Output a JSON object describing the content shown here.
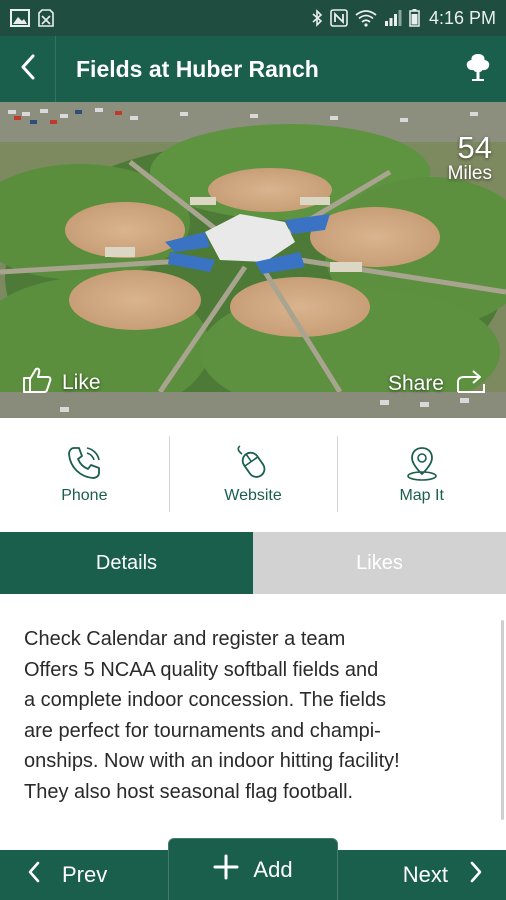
{
  "status_bar": {
    "time": "4:16 PM",
    "left_icons": [
      "image-icon",
      "sim-off-icon"
    ],
    "right_icons": [
      "bluetooth-icon",
      "nfc-icon",
      "wifi-icon",
      "signal-icon",
      "battery-icon"
    ]
  },
  "app_bar": {
    "title": "Fields at Huber Ranch",
    "back_icon": "chevron-left-icon",
    "action_icon": "tree-icon"
  },
  "hero": {
    "distance_value": "54",
    "distance_unit": "Miles",
    "like_label": "Like",
    "share_label": "Share"
  },
  "actions": [
    {
      "label": "Phone",
      "icon": "phone-icon"
    },
    {
      "label": "Website",
      "icon": "mouse-icon"
    },
    {
      "label": "Map It",
      "icon": "map-pin-icon"
    }
  ],
  "tabs": [
    {
      "label": "Details",
      "active": true
    },
    {
      "label": "Likes",
      "active": false
    }
  ],
  "description": {
    "lines": [
      "Check Calendar and register a team",
      "Offers 5 NCAA quality softball fields and",
      "a complete indoor concession. The fields",
      "are perfect for tournaments and champi-",
      "onships. Now with an indoor hitting facility!",
      "They also host seasonal flag football."
    ]
  },
  "bottom_nav": {
    "prev_label": "Prev",
    "add_label": "Add",
    "next_label": "Next"
  },
  "colors": {
    "brand_green": "#1a5f4c",
    "status_bar": "#1f4d3f",
    "inactive_tab": "#d2d2d2",
    "text": "#2a2a2a"
  }
}
